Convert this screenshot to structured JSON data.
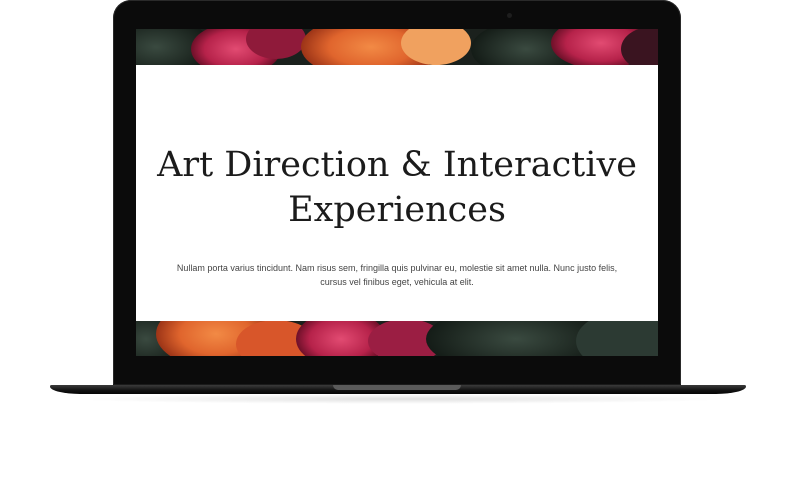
{
  "hero": {
    "title_line1": "Art Direction & Interactive",
    "title_line2": "Experiences",
    "body": "Nullam porta varius tincidunt. Nam risus sem, fringilla quis pulvinar eu, molestie sit amet nulla. Nunc justo felis, cursus vel finibus eget, vehicula at elit."
  },
  "colors": {
    "bezel": "#0b0b0b",
    "card": "#ffffff",
    "headline": "#1b1b1b",
    "body_text": "#444444",
    "flower_pink": "#c4264f",
    "flower_orange": "#e0652d",
    "foliage": "#1f2b25"
  },
  "icons": [
    "camera-icon"
  ]
}
